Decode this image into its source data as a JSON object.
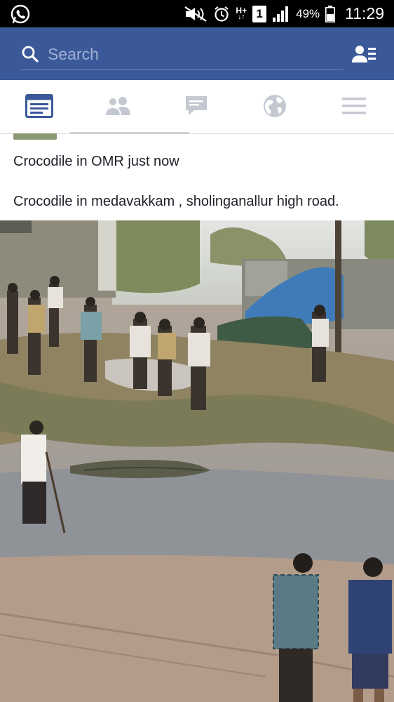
{
  "status_bar": {
    "battery": "49%",
    "time": "11:29",
    "network": "H+",
    "sim": "1",
    "icons": [
      "whatsapp-icon",
      "mute-icon",
      "alarm-icon",
      "network-icon",
      "sim-icon",
      "signal-icon",
      "battery-icon"
    ]
  },
  "header": {
    "search_placeholder": "Search",
    "icons": [
      "search-icon",
      "friend-requests-icon"
    ]
  },
  "tabs": [
    {
      "name": "news-feed",
      "icon": "news-feed-icon",
      "active": true
    },
    {
      "name": "friends",
      "icon": "friends-icon",
      "active": false
    },
    {
      "name": "messages",
      "icon": "messages-icon",
      "active": false
    },
    {
      "name": "notifications",
      "icon": "globe-icon",
      "active": false
    },
    {
      "name": "more",
      "icon": "menu-icon",
      "active": false
    }
  ],
  "post": {
    "line1": "Crocodile in OMR just now",
    "line2": "Crocodile in medavakkam , sholinganallur high road."
  },
  "colors": {
    "brand": "#3b5998",
    "active_tab": "#3b5998",
    "inactive_tab": "#c4c9d1",
    "text": "#1d2129"
  }
}
